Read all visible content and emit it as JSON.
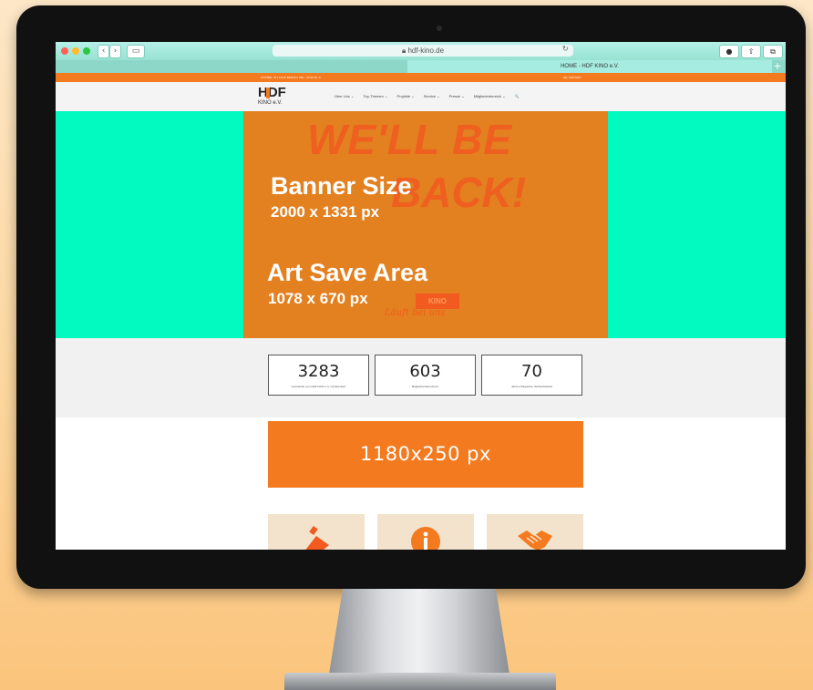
{
  "browser": {
    "url": "hdf-kino.de",
    "tab_title": "HOME - HDF KINO e.V.",
    "back_label": "‹",
    "forward_label": "›",
    "sidebar_label": "▭",
    "reload_label": "↻",
    "info_label": "●",
    "share_label": "⇧",
    "tabs_label": "⧉",
    "new_tab_label": "+"
  },
  "site": {
    "topbar_left": "KOSTEN, 30 | 10115 BERLIN | 030 – 23 00 40 -0",
    "topbar_right": "NE: KONTAKT",
    "logo_text": "HDF",
    "logo_sub": "KINO e.V.",
    "menu": [
      "Über Uns ⌄",
      "Top-Themen ⌄",
      "Projekte ⌄",
      "Service ⌄",
      "Presse ⌄",
      "Mitgliederbereich ⌄",
      "🔍"
    ],
    "hero": {
      "ghost_line1": "WE'LL BE",
      "ghost_line2": "BACK!",
      "ghost_badge": "KINO",
      "ghost_script": "Läuft bei uns",
      "banner_size_title": "Banner Size",
      "banner_size_value": "2000 x 1331 px",
      "safe_area_title": "Art Save Area",
      "safe_area_value": "1078 x 670 px"
    },
    "stats": [
      {
        "value": "3283",
        "label": "Leinwände vom HDF KINO e.V. repräsentiert"
      },
      {
        "value": "603",
        "label": "Mitgliedsunternehmen"
      },
      {
        "value": "70",
        "label": "Jahre erfolgreiche Verbandsarbeit"
      }
    ],
    "promo_text": "1180x250 px",
    "tile_icons": [
      "megaphone-icon",
      "info-icon",
      "handshake-icon"
    ]
  },
  "colors": {
    "accent_orange": "#f47a1f",
    "hero_mint": "#02f9c0",
    "banner_orange": "#e38020"
  }
}
